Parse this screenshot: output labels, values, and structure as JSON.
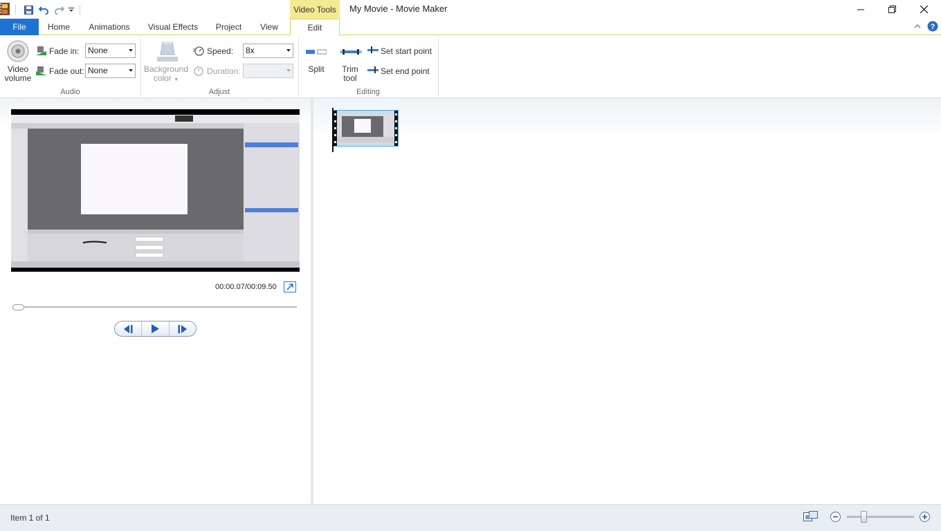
{
  "window": {
    "title": "My Movie - Movie Maker",
    "context_tab_label": "Video Tools",
    "controls": [
      "minimize",
      "restore",
      "close"
    ]
  },
  "quick_access": {
    "icons": [
      "save-icon",
      "undo-icon",
      "redo-icon",
      "customize-dropdown-icon"
    ]
  },
  "tabs": [
    {
      "label": "File",
      "active": false
    },
    {
      "label": "Home",
      "active": false
    },
    {
      "label": "Animations",
      "active": false
    },
    {
      "label": "Visual Effects",
      "active": false
    },
    {
      "label": "Project",
      "active": false
    },
    {
      "label": "View",
      "active": false
    },
    {
      "label": "Edit",
      "active": true
    }
  ],
  "ribbon": {
    "audio": {
      "group_label": "Audio",
      "video_volume_line1": "Video",
      "video_volume_line2": "volume",
      "fade_in_label": "Fade in:",
      "fade_in_value": "None",
      "fade_out_label": "Fade out:",
      "fade_out_value": "None"
    },
    "adjust": {
      "group_label": "Adjust",
      "background_color_line1": "Background",
      "background_color_line2": "color",
      "speed_label": "Speed:",
      "speed_value": "8x",
      "duration_label": "Duration:",
      "duration_value": ""
    },
    "editing": {
      "group_label": "Editing",
      "split_label": "Split",
      "trim_tool_line1": "Trim",
      "trim_tool_line2": "tool",
      "set_start_point": "Set start point",
      "set_end_point": "Set end point"
    }
  },
  "preview": {
    "time_readout": "00:00.07/00:09.50",
    "seek_position": 0.007
  },
  "storyboard": {
    "clips": [
      {
        "selected": true
      }
    ]
  },
  "status": {
    "text": "Item 1 of 1",
    "zoom_level": 0.25
  },
  "colors": {
    "file_tab": "#1e73d0",
    "context_tab": "#f3ea91",
    "accent_blue": "#2a7bd0"
  }
}
